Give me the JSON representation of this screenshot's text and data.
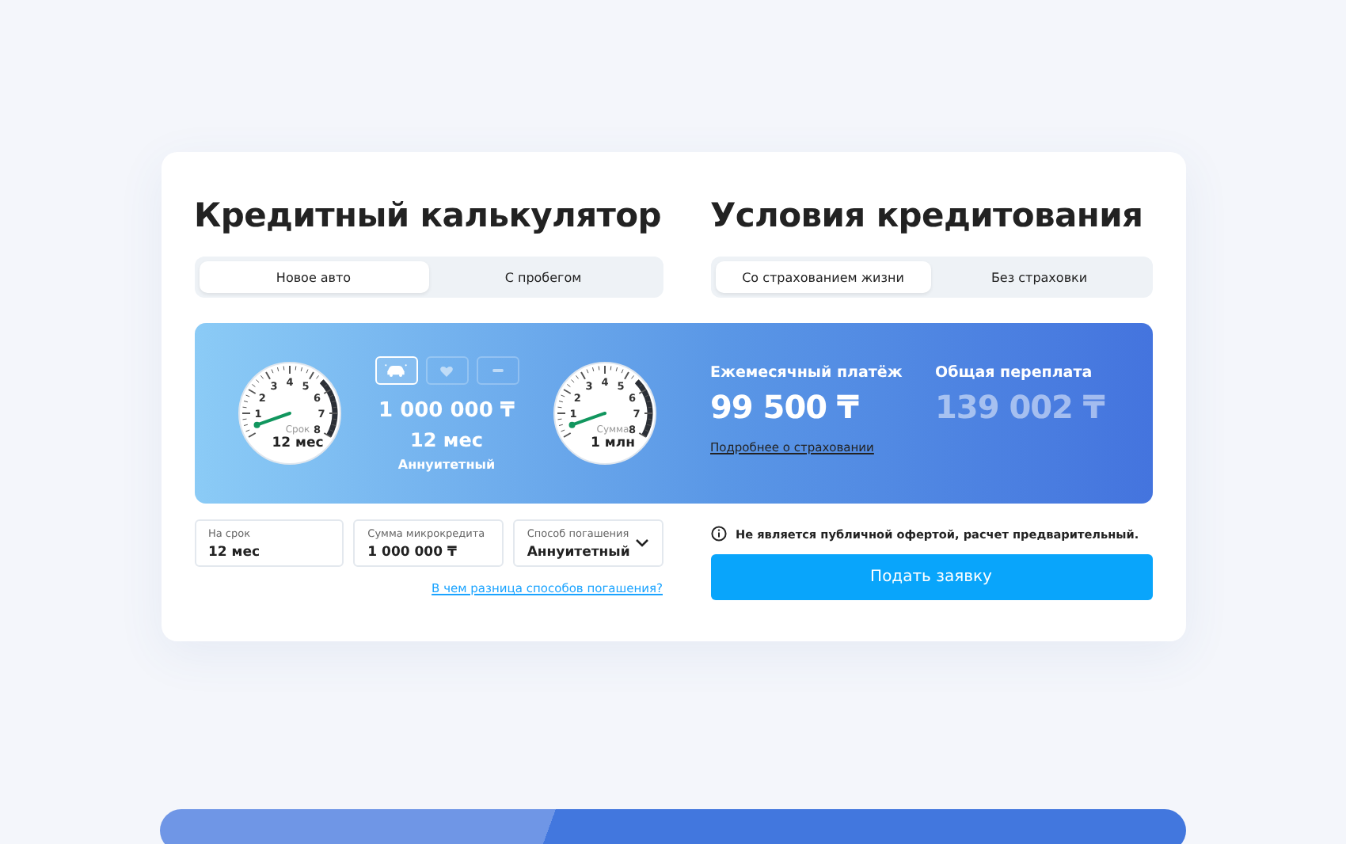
{
  "calculator": {
    "title": "Кредитный калькулятор",
    "tabs": [
      {
        "label": "Новое авто",
        "selected": true
      },
      {
        "label": "С пробегом",
        "selected": false
      }
    ],
    "gauges": [
      {
        "caption": "Срок",
        "value": "12 мес",
        "scale": [
          "1",
          "2",
          "3",
          "4",
          "5",
          "6",
          "7",
          "8"
        ]
      },
      {
        "caption": "Сумма",
        "value": "1 млн",
        "scale": [
          "1",
          "2",
          "3",
          "4",
          "5",
          "6",
          "7",
          "8"
        ]
      }
    ],
    "type_buttons": [
      {
        "kind": "car",
        "selected": true
      },
      {
        "kind": "heart",
        "selected": false
      },
      {
        "kind": "bar",
        "selected": false
      }
    ],
    "summary": {
      "amount": "1 000 000 ₸",
      "term": "12 мес",
      "method": "Аннуитетный"
    },
    "fields": [
      {
        "kind": "text",
        "label": "На срок",
        "value": "12 мес"
      },
      {
        "kind": "text",
        "label": "Сумма микрокредита",
        "value": "1 000 000 ₸"
      },
      {
        "kind": "select",
        "label": "Способ погашения",
        "value": "Аннуитетный"
      }
    ],
    "link": "В чем разница способов погашения?"
  },
  "conditions": {
    "title": "Условия кредитования",
    "tabs": [
      {
        "label": "Со страхованием жизни",
        "selected": true
      },
      {
        "label": "Без страховки",
        "selected": false
      }
    ],
    "results": [
      {
        "label": "Ежемесячный платёж",
        "value": "99 500 ₸",
        "muted": false
      },
      {
        "label": "Общая переплата",
        "value": "139 002 ₸",
        "muted": true
      }
    ],
    "link": "Подробнее о страховании",
    "notice": "Не является публичной офертой, расчет предварительный.",
    "button": "Подать заявку"
  }
}
